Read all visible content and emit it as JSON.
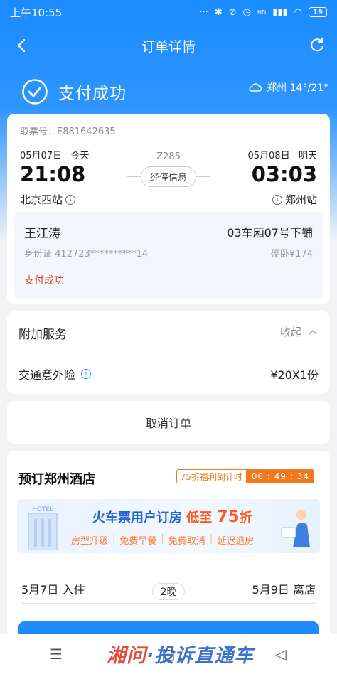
{
  "status_bar": {
    "time": "上午10:55",
    "signal_label": "HD",
    "battery": "19"
  },
  "nav": {
    "title": "订单详情"
  },
  "payment": {
    "status": "支付成功"
  },
  "weather": {
    "text": "郑州 14°/21°"
  },
  "ticket": {
    "ticket_no": "取票号：E881642635",
    "departure": {
      "date": "05月07日",
      "day": "今天",
      "time": "21:08",
      "station": "北京西站"
    },
    "arrival": {
      "date": "05月08日",
      "day": "明天",
      "time": "03:03",
      "station": "郑州站"
    },
    "train_no": "Z285",
    "stops_label": "经停信息",
    "passenger": {
      "name": "王江涛",
      "seat": "03车厢07号下铺",
      "id": "身份证 412723**********14",
      "price": "硬卧¥174",
      "status": "支付成功"
    }
  },
  "extra_services": {
    "title": "附加服务",
    "collapse_label": "收起",
    "insurance_label": "交通意外险",
    "insurance_value": "¥20X1份"
  },
  "cancel_label": "取消订单",
  "hotel": {
    "title": "预订郑州酒店",
    "countdown_label": "75折福利倒计时",
    "countdown_time": "00 : 49 : 34",
    "banner": {
      "sign": "HOTEL",
      "headline": "火车票用户订房",
      "headline_2": "低至",
      "discount": "75",
      "discount_unit": "折",
      "perks": [
        "房型升级",
        "免费早餐",
        "免费取消",
        "延迟退房"
      ]
    },
    "checkin": "5月7日 入住",
    "checkout": "5月9日 离店",
    "nights": "2晚"
  },
  "watermark": {
    "part1": "湘问",
    "part2": "·投诉直通车"
  },
  "colors": {
    "accent": "#1e8bff",
    "alert": "#e2402d",
    "promo": "#f07a1c"
  }
}
